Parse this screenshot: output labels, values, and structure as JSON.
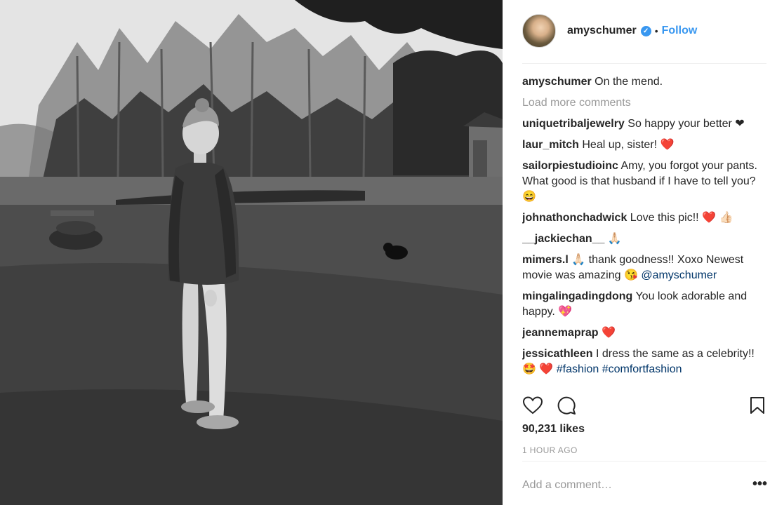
{
  "post": {
    "author": "amyschumer",
    "follow_label": "Follow",
    "separator": "•",
    "caption_user": "amyschumer",
    "caption_text": "On the mend.",
    "load_more_label": "Load more comments",
    "likes": "90,231 likes",
    "timestamp": "1 HOUR AGO",
    "add_comment_placeholder": "Add a comment…",
    "more_options": "•••"
  },
  "comments": [
    {
      "user": "uniquetribaljewelry",
      "text": "So happy your better ❤"
    },
    {
      "user": "laur_mitch",
      "text": "Heal up, sister! ❤️"
    },
    {
      "user": "sailorpiestudioinc",
      "text": "Amy, you forgot your pants. What good is that husband if I have to tell you? 😄"
    },
    {
      "user": "johnathonchadwick",
      "text": "Love this pic!! ❤️ 👍🏻"
    },
    {
      "user": "__jackiechan__",
      "text": "🙏🏻"
    },
    {
      "user": "mimers.l",
      "text": "🙏🏻  thank goodness!! Xoxo Newest movie was amazing 😘",
      "mention": "@amyschumer"
    },
    {
      "user": "mingalingadingdong",
      "text": "You look adorable and happy. 💖"
    },
    {
      "user": "jeannemaprap",
      "text": "❤️"
    },
    {
      "user": "jessicathleen",
      "text": "I dress the same as a celebrity!! 🤩 ❤️",
      "tags": "#fashion #comfortfashion"
    }
  ],
  "icons": {
    "verified": "verified-badge-icon",
    "like": "heart-icon",
    "comment": "comment-bubble-icon",
    "save": "bookmark-icon"
  },
  "colors": {
    "accent": "#3897f0",
    "link": "#003569",
    "muted": "#999999"
  }
}
